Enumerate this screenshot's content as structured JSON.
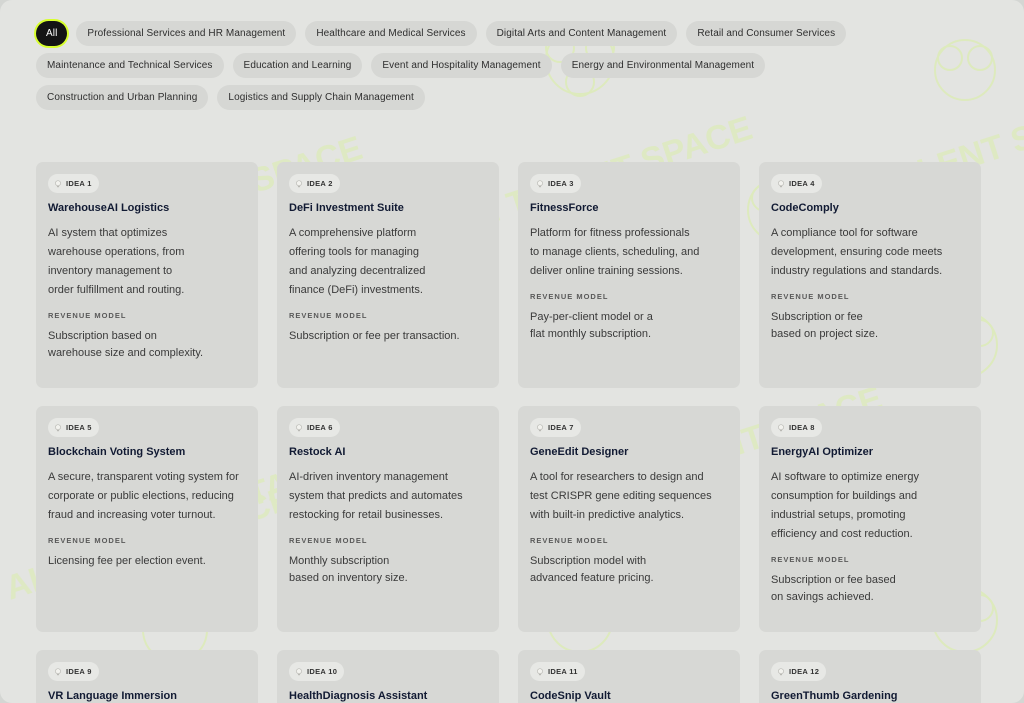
{
  "filters": [
    "All",
    "Professional Services and HR Management",
    "Healthcare and Medical Services",
    "Digital Arts and Content Management",
    "Retail and Consumer Services",
    "Maintenance and Technical Services",
    "Education and Learning",
    "Event and Hospitality Management",
    "Energy and Environmental Management",
    "Construction and Urban Planning",
    "Logistics and Supply Chain Management"
  ],
  "revenue_label": "REVENUE MODEL",
  "watermark_text": "AI TALENT SPACE",
  "accent_color": "#d8ff2e",
  "ideas": [
    {
      "tag": "IDEA 1",
      "title": "WarehouseAI Logistics",
      "desc": [
        "AI system that optimizes",
        "warehouse operations, from",
        "inventory management to",
        "order fulfillment and routing."
      ],
      "revenue": [
        "Subscription based on",
        "warehouse size and complexity."
      ]
    },
    {
      "tag": "IDEA 2",
      "title": "DeFi Investment Suite",
      "desc": [
        "A comprehensive platform",
        "offering tools for managing",
        "and analyzing decentralized",
        "finance (DeFi) investments."
      ],
      "revenue": [
        "Subscription or fee per transaction."
      ]
    },
    {
      "tag": "IDEA 3",
      "title": "FitnessForce",
      "desc": [
        "Platform for fitness professionals",
        "to manage clients, scheduling, and",
        "deliver online training sessions."
      ],
      "revenue": [
        "Pay-per-client model or a",
        "flat monthly subscription."
      ]
    },
    {
      "tag": "IDEA 4",
      "title": "CodeComply",
      "desc": [
        "A compliance tool for software",
        "development, ensuring code meets",
        "industry regulations and standards."
      ],
      "revenue": [
        "Subscription or fee",
        "based on project size."
      ]
    },
    {
      "tag": "IDEA 5",
      "title": "Blockchain Voting System",
      "desc": [
        "A secure, transparent voting system for",
        "corporate or public elections, reducing",
        "fraud and increasing voter turnout."
      ],
      "revenue": [
        "Licensing fee per election event."
      ]
    },
    {
      "tag": "IDEA 6",
      "title": "Restock AI",
      "desc": [
        "AI-driven inventory management",
        "system that predicts and automates",
        "restocking for retail businesses."
      ],
      "revenue": [
        "Monthly subscription",
        "based on inventory size."
      ]
    },
    {
      "tag": "IDEA 7",
      "title": "GeneEdit Designer",
      "desc": [
        "A tool for researchers to design and",
        "test CRISPR gene editing sequences",
        "with built-in predictive analytics."
      ],
      "revenue": [
        "Subscription model with",
        "advanced feature pricing."
      ]
    },
    {
      "tag": "IDEA 8",
      "title": "EnergyAI Optimizer",
      "desc": [
        "AI software to optimize energy",
        "consumption for buildings and",
        "industrial setups, promoting",
        "efficiency and cost reduction."
      ],
      "revenue": [
        "Subscription or fee based",
        "on savings achieved."
      ]
    },
    {
      "tag": "IDEA 9",
      "title": "VR Language Immersion",
      "desc": [],
      "revenue": []
    },
    {
      "tag": "IDEA 10",
      "title": "HealthDiagnosis Assistant",
      "desc": [],
      "revenue": []
    },
    {
      "tag": "IDEA 11",
      "title": "CodeSnip Vault",
      "desc": [],
      "revenue": []
    },
    {
      "tag": "IDEA 12",
      "title": "GreenThumb Gardening",
      "desc": [],
      "revenue": []
    }
  ]
}
